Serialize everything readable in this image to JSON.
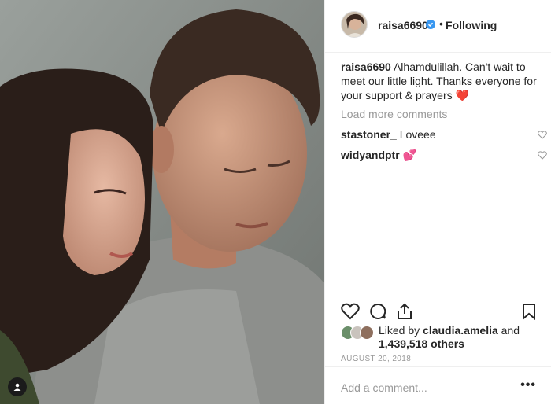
{
  "header": {
    "username": "raisa6690",
    "separator": "•",
    "follow_label": "Following"
  },
  "caption": {
    "username": "raisa6690",
    "text": " Alhamdulillah. Can't wait to meet our little light. Thanks everyone for your support & prayers ",
    "emoji": "❤️"
  },
  "load_more": "Load more comments",
  "comments": [
    {
      "username": "stastoner_",
      "text": " Loveee"
    },
    {
      "username": "widyandptr",
      "text": " 💕"
    }
  ],
  "likes": {
    "prefix": "Liked by ",
    "user": "claudia.amelia",
    "middle": " and",
    "count": "1,439,518 others"
  },
  "date": "AUGUST 20, 2018",
  "add_comment": {
    "placeholder": "Add a comment..."
  },
  "more": "•••",
  "colors": {
    "verified": "#3897f0",
    "heart": "#ed4956",
    "muted": "#999999",
    "border": "#efefef"
  },
  "icons": [
    "heart-icon",
    "comment-icon",
    "share-icon",
    "bookmark-icon",
    "verified-icon",
    "user-tag-icon"
  ]
}
